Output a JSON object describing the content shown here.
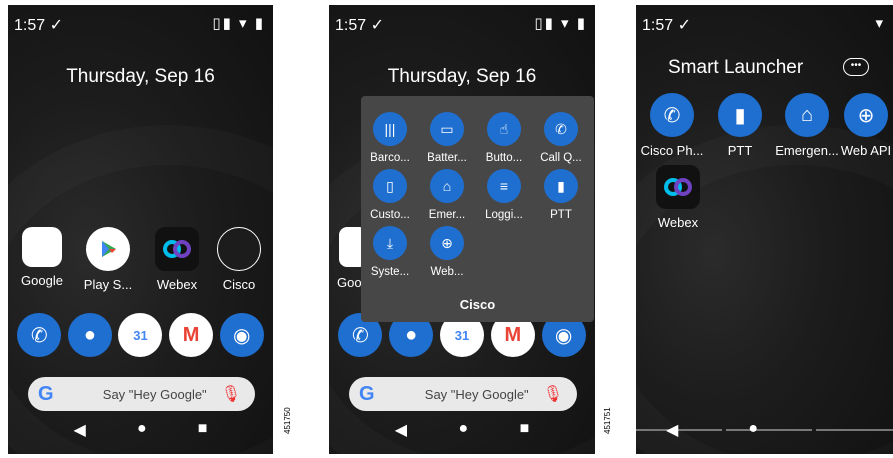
{
  "screen1": {
    "status_time": "1:57 ✓",
    "status_icons": "▯▮ ▾ ▮",
    "date": "Thursday, Sep 16",
    "apps": [
      {
        "label": "Google"
      },
      {
        "label": "Play S..."
      },
      {
        "label": "Webex"
      },
      {
        "label": "Cisco"
      }
    ],
    "search_placeholder": "Say \"Hey Google\""
  },
  "screen2": {
    "status_time": "1:57 ✓",
    "status_icons": "▯▮ ▾ ▮",
    "date": "Thursday, Sep 16",
    "folder_title": "Cisco",
    "folder_apps": [
      {
        "label": "Barco..."
      },
      {
        "label": "Batter..."
      },
      {
        "label": "Butto..."
      },
      {
        "label": "Call Q..."
      },
      {
        "label": "Custo..."
      },
      {
        "label": "Emer..."
      },
      {
        "label": "Loggi..."
      },
      {
        "label": "PTT"
      },
      {
        "label": "Syste..."
      },
      {
        "label": "Web..."
      }
    ],
    "partial_label": "Goo",
    "search_placeholder": "Say \"Hey Google\""
  },
  "screen3": {
    "status_time": "1:57 ✓",
    "status_icons": "▾",
    "title": "Smart Launcher",
    "apps": [
      {
        "label": "Cisco Ph..."
      },
      {
        "label": "PTT"
      },
      {
        "label": "Emergen..."
      },
      {
        "label": "Web API"
      },
      {
        "label": "Webex"
      }
    ]
  },
  "figure_ids": [
    "451750",
    "451751"
  ]
}
